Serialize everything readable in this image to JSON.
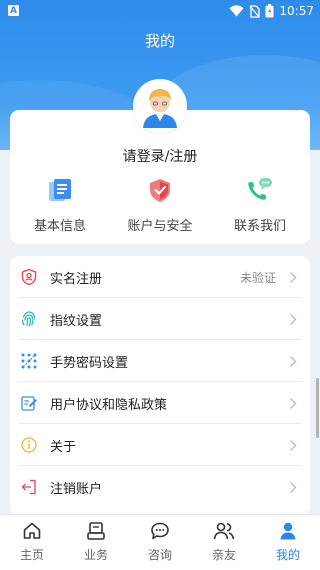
{
  "status_bar": {
    "time": "10:57",
    "left_badge": "A"
  },
  "header": {
    "title": "我的"
  },
  "profile": {
    "login_prompt": "请登录/注册"
  },
  "quick_actions": [
    {
      "label": "基本信息",
      "icon": "document-icon"
    },
    {
      "label": "账户与安全",
      "icon": "shield-check-icon"
    },
    {
      "label": "联系我们",
      "icon": "phone-chat-icon"
    }
  ],
  "menu": [
    {
      "label": "实名注册",
      "status": "未验证",
      "icon": "id-card-icon"
    },
    {
      "label": "指纹设置",
      "status": "",
      "icon": "fingerprint-icon"
    },
    {
      "label": "手势密码设置",
      "status": "",
      "icon": "gesture-grid-icon"
    },
    {
      "label": "用户协议和隐私政策",
      "status": "",
      "icon": "edit-document-icon"
    },
    {
      "label": "关于",
      "status": "",
      "icon": "info-icon"
    },
    {
      "label": "注销账户",
      "status": "",
      "icon": "logout-icon"
    }
  ],
  "bottom_nav": [
    {
      "label": "主页",
      "icon": "home-icon",
      "active": false
    },
    {
      "label": "业务",
      "icon": "business-icon",
      "active": false
    },
    {
      "label": "咨询",
      "icon": "chat-bubble-icon",
      "active": false
    },
    {
      "label": "亲友",
      "icon": "people-icon",
      "active": false
    },
    {
      "label": "我的",
      "icon": "person-icon",
      "active": true
    }
  ],
  "colors": {
    "primary": "#3a93ee",
    "active_nav": "#2f86ea",
    "page_bg": "#eef1f6"
  }
}
